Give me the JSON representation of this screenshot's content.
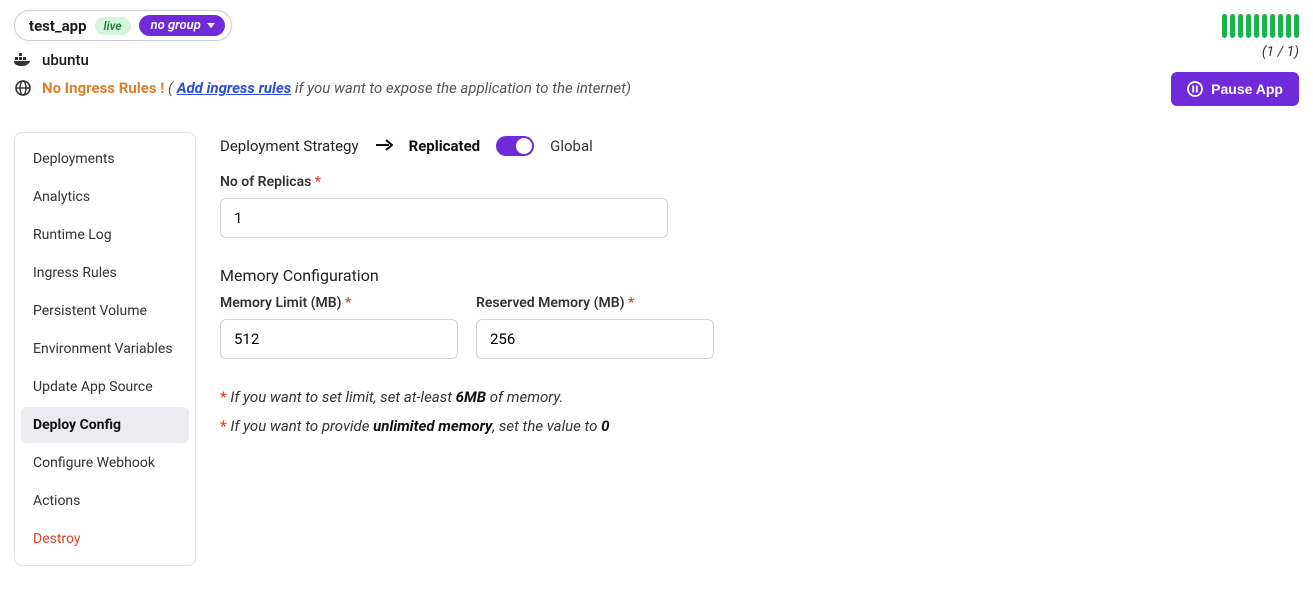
{
  "app": {
    "name": "test_app",
    "status_badge": "live",
    "group_badge": "no group",
    "image": "ubuntu"
  },
  "ingress": {
    "warning": "No Ingress Rules !",
    "open_paren": "( ",
    "link": "Add ingress rules",
    "suffix": " if you want to expose the application to the internet)"
  },
  "replicas": {
    "count_text": "(1 / 1)",
    "bar_count": 10
  },
  "pause_label": "Pause App",
  "sidebar": {
    "items": [
      {
        "label": "Deployments"
      },
      {
        "label": "Analytics"
      },
      {
        "label": "Runtime Log"
      },
      {
        "label": "Ingress Rules"
      },
      {
        "label": "Persistent Volume"
      },
      {
        "label": "Environment Variables"
      },
      {
        "label": "Update App Source"
      },
      {
        "label": "Deploy Config"
      },
      {
        "label": "Configure Webhook"
      },
      {
        "label": "Actions"
      },
      {
        "label": "Destroy"
      }
    ],
    "active_index": 7,
    "destroy_index": 10
  },
  "strategy": {
    "label": "Deployment Strategy",
    "mode_a": "Replicated",
    "mode_b": "Global"
  },
  "form": {
    "replicas_label": "No of Replicas ",
    "replicas_value": "1",
    "memory_section": "Memory Configuration",
    "mem_limit_label": "Memory Limit (MB) ",
    "mem_limit_value": "512",
    "reserved_label": "Reserved Memory (MB) ",
    "reserved_value": "256"
  },
  "notes": {
    "n1_a": " If you want to set limit, set at-least ",
    "n1_b": "6MB",
    "n1_c": " of memory.",
    "n2_a": " If you want to provide ",
    "n2_b": "unlimited memory",
    "n2_c": ", set the value to ",
    "n2_d": "0"
  }
}
